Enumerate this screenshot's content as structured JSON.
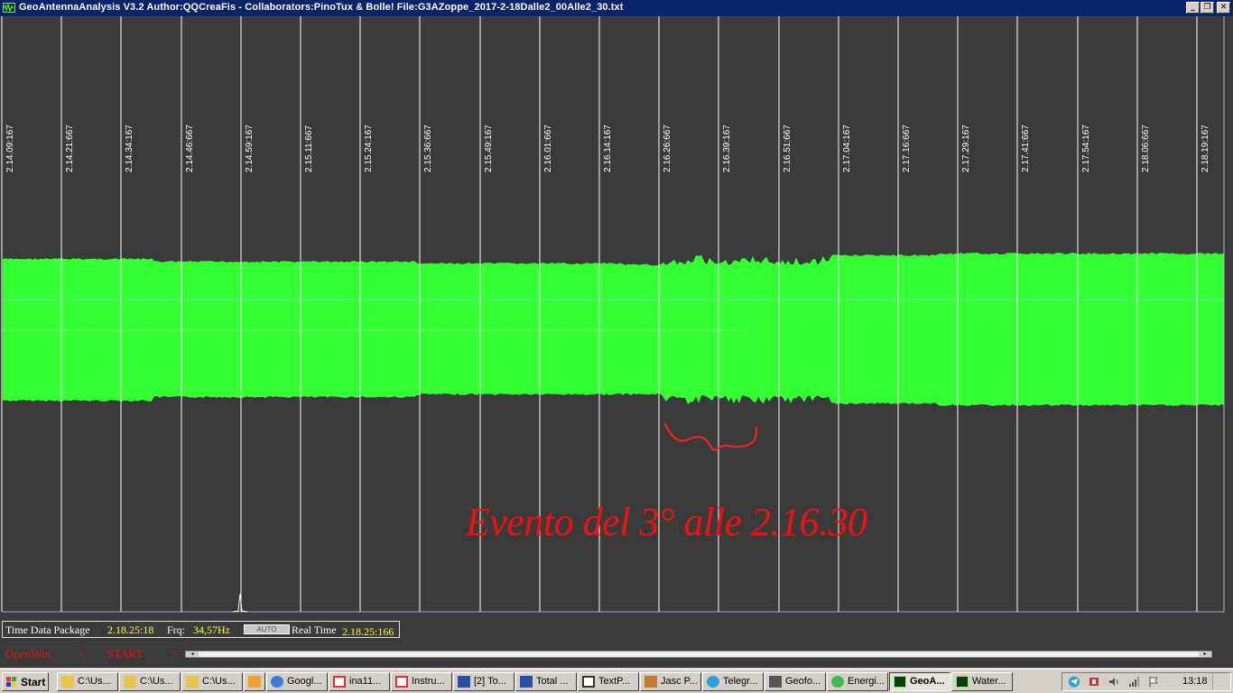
{
  "window": {
    "title": "GeoAntennaAnalysis V3.2 Author:QQCreaFis - Collaborators:PinoTux & Bolle!    File:G3AZoppe_2017-2-18Dalle2_00Alle2_30.txt",
    "icon": "waveform-icon",
    "controls": [
      "minimize-icon",
      "restore-icon",
      "close-icon"
    ]
  },
  "plot": {
    "background": "#3a3a3a",
    "signal_color": "#33ff33",
    "grid_color": "#ffffff",
    "time_ticks": [
      "2.14.09:167",
      "2.14.21:667",
      "2.14.34:167",
      "2.14.46:667",
      "2.14.59:167",
      "2.15.11:667",
      "2.15.24:167",
      "2.15.36:667",
      "2.15.49:167",
      "2.16.01:667",
      "2.16.14:167",
      "2.16.26:667",
      "2.16.39:167",
      "2.16.51:667",
      "2.17.04:167",
      "2.17.16:667",
      "2.17.29:167",
      "2.17.41:667",
      "2.17.54:167",
      "2.18.06:667",
      "2.18.19:167"
    ],
    "annotation": "Evento del 3° alle 2.16.30",
    "annotation_color": "#ee1111"
  },
  "status": {
    "package_label": "Time Data Package",
    "package_value": "2.18.25:18",
    "frq_label": "Frq:",
    "frq_value": "34,57Hz",
    "auto_label": "AUTO",
    "realtime_label": "Real Time",
    "realtime_value": "2.18.25:166"
  },
  "controls": {
    "openwin": "OpenWin",
    "prev": "<",
    "start": "START",
    "next": ">"
  },
  "taskbar": {
    "start_label": "Start",
    "items": [
      {
        "label": "C:\\Us...",
        "icon": "folder-icon"
      },
      {
        "label": "C:\\Us...",
        "icon": "folder-icon"
      },
      {
        "label": "C:\\Us...",
        "icon": "folder-icon"
      },
      {
        "label": "",
        "icon": "media-player-icon"
      },
      {
        "label": "Googl...",
        "icon": "google-earth-icon"
      },
      {
        "label": "ina11...",
        "icon": "pdf-icon"
      },
      {
        "label": "Instru...",
        "icon": "pdf-icon"
      },
      {
        "label": "[2] To...",
        "icon": "floppy-icon"
      },
      {
        "label": "Total ...",
        "icon": "floppy-icon"
      },
      {
        "label": "TextP...",
        "icon": "text-editor-icon"
      },
      {
        "label": "Jasc P...",
        "icon": "paint-icon"
      },
      {
        "label": "Telegr...",
        "icon": "telegram-icon"
      },
      {
        "label": "Geofo...",
        "icon": "tools-icon"
      },
      {
        "label": "Energi...",
        "icon": "chrome-icon"
      },
      {
        "label": "GeoA...",
        "icon": "waveform-icon",
        "active": true
      },
      {
        "label": "Water...",
        "icon": "waveform-icon"
      }
    ],
    "clock": "13:18"
  }
}
